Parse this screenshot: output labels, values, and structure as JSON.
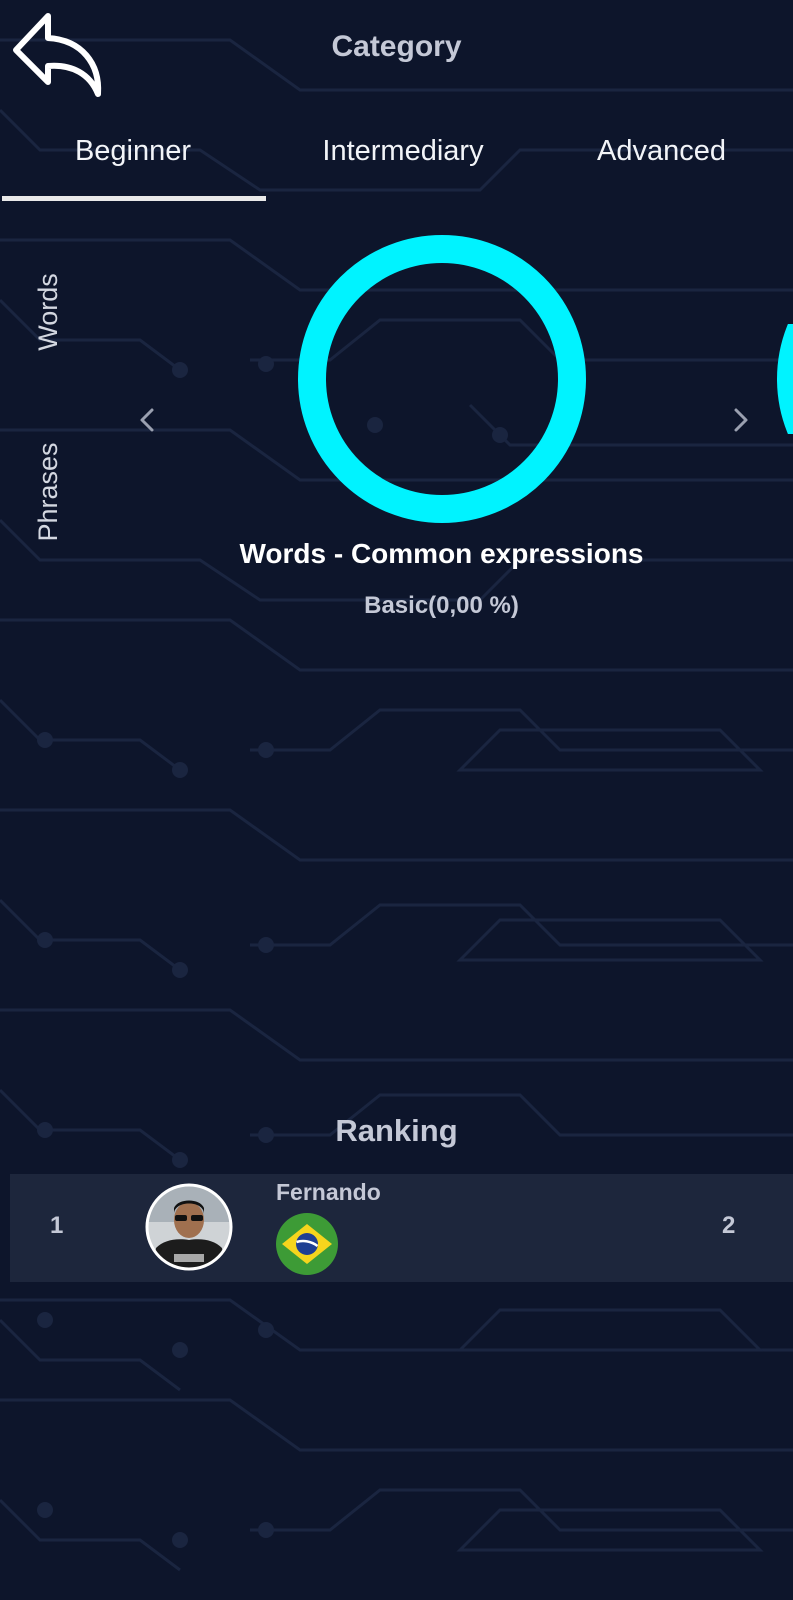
{
  "header": {
    "title": "Category",
    "back_icon": "back-arrow-icon"
  },
  "level_tabs": {
    "items": [
      {
        "label": "Beginner",
        "selected": true
      },
      {
        "label": "Intermediary",
        "selected": false
      },
      {
        "label": "Advanced",
        "selected": false
      }
    ]
  },
  "type_tabs": {
    "items": [
      {
        "label": "Words"
      },
      {
        "label": "Phrases"
      }
    ]
  },
  "carousel": {
    "prev_icon": "chevron-left-icon",
    "next_icon": "chevron-right-icon",
    "ring_color": "#00f3ff",
    "current": {
      "title": "Words - Common expressions",
      "progress_text": "Basic(0,00 %)",
      "progress": 0
    }
  },
  "ranking": {
    "title": "Ranking",
    "rows": [
      {
        "position": "1",
        "name": "Fernando",
        "country_flag": "brazil-flag-icon",
        "score": "2"
      }
    ]
  },
  "colors": {
    "background": "#0d152b",
    "row_background": "#1d263c",
    "accent": "#00f3ff",
    "muted_text": "#c4c8d6"
  }
}
